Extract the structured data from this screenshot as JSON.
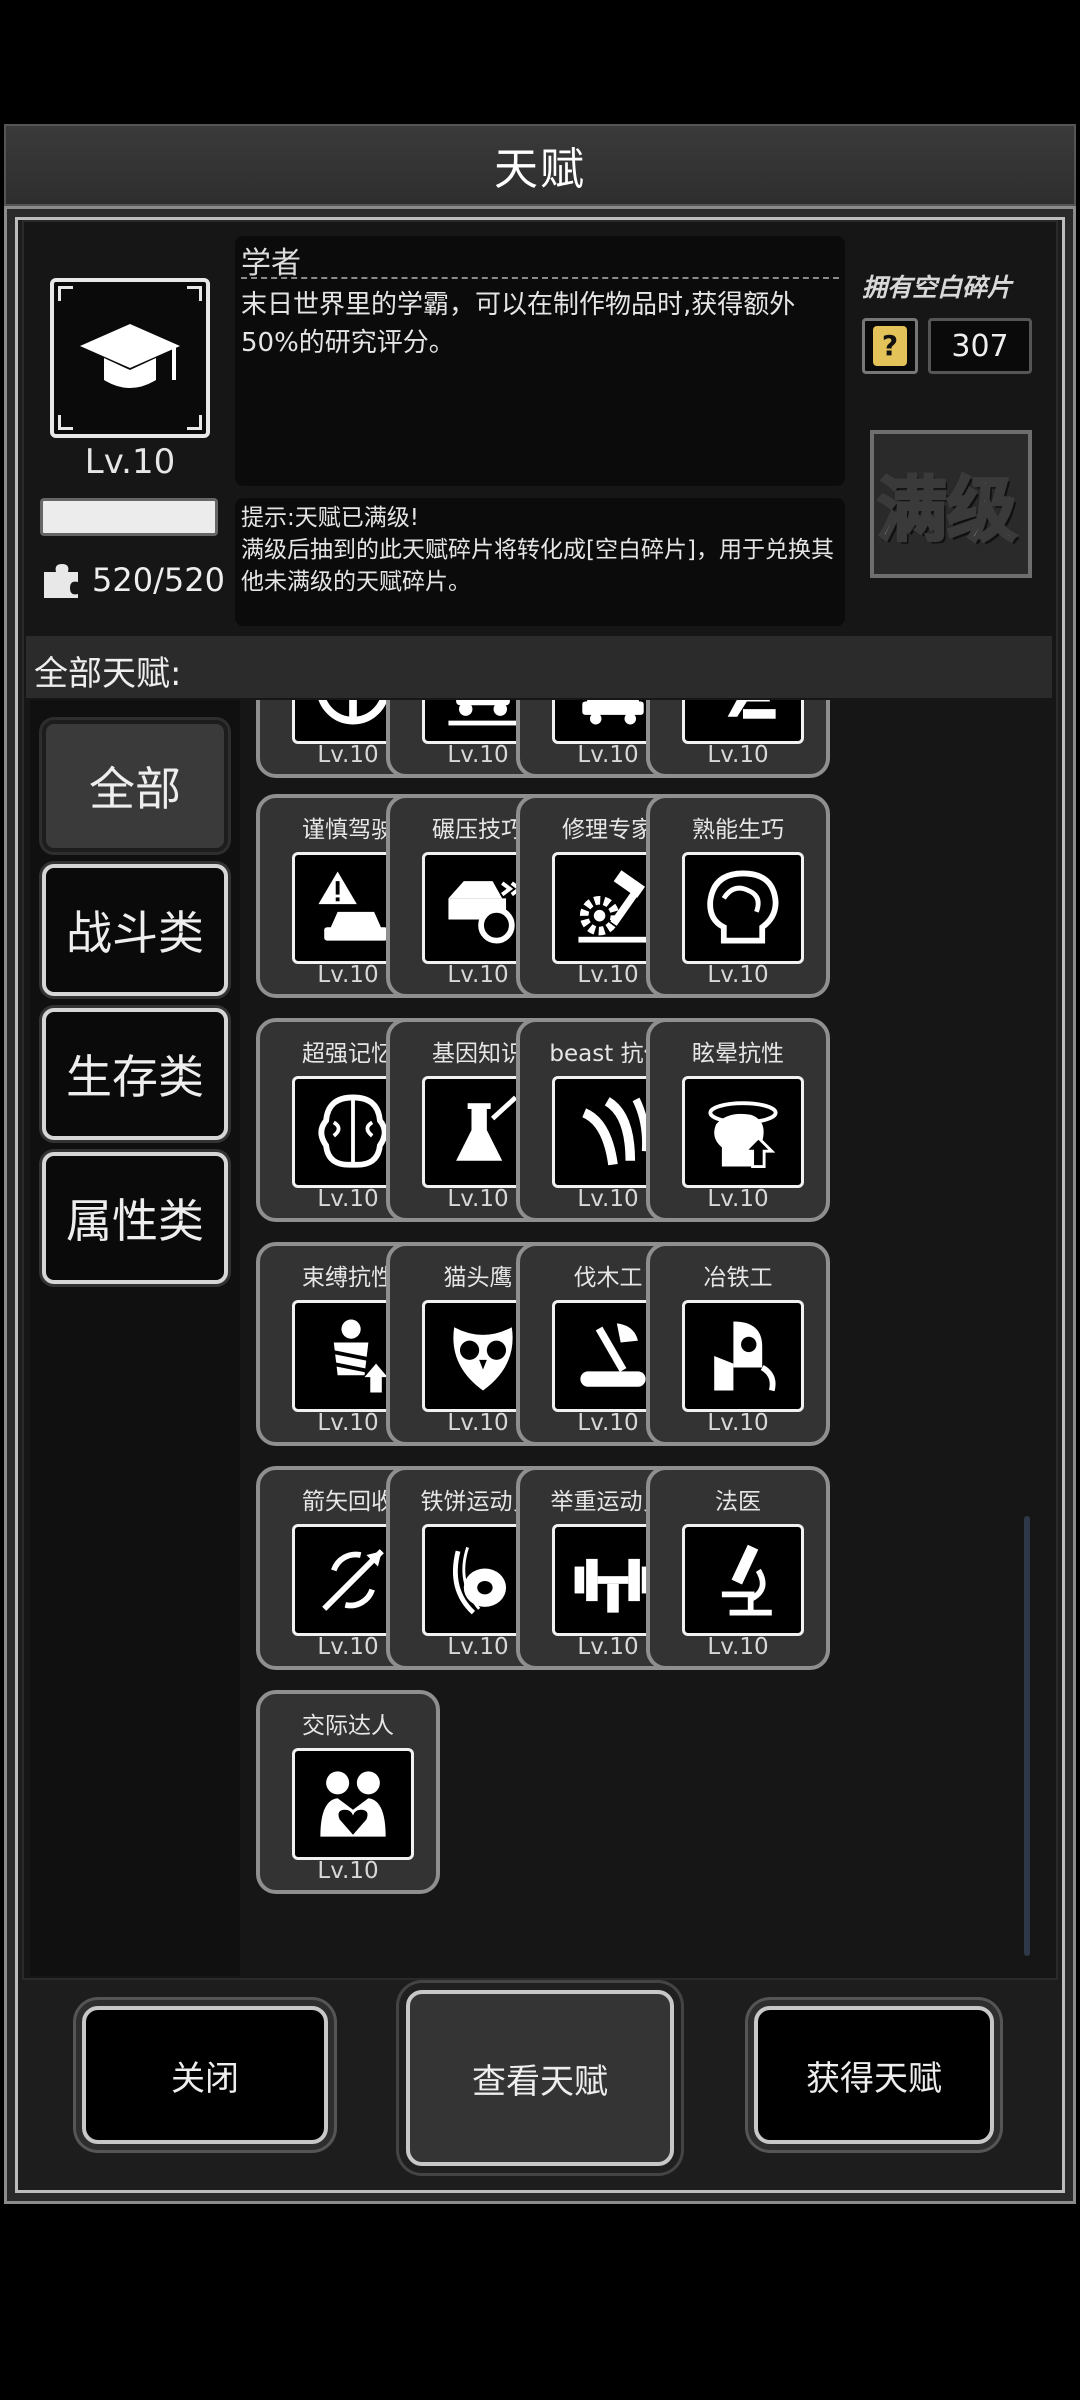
{
  "title": "天赋",
  "selected": {
    "name": "学者",
    "level": "Lv.10",
    "description": "末日世界里的学霸，可以在制作物品时,获得额外50%的研究评分。",
    "hint_line1": "提示:天赋已满级!",
    "hint_line2": "满级后抽到的此天赋碎片将转化成[空白碎片]，用于兑换其他未满级的天赋碎片。",
    "fragments": "520/520",
    "xp_fill_fraction": 1.0,
    "icon": "graduation-cap-icon"
  },
  "blank_fragments": {
    "label": "拥有空白碎片",
    "count": "307",
    "icon": "question-card-icon"
  },
  "max_badge": "满级",
  "all_talents_label": "全部天赋:",
  "categories": [
    {
      "label": "全部",
      "active": true
    },
    {
      "label": "战斗类",
      "active": false
    },
    {
      "label": "生存类",
      "active": false
    },
    {
      "label": "属性类",
      "active": false
    }
  ],
  "talents": [
    {
      "name": "",
      "level": "Lv.10",
      "icon": "steering-wheel-icon"
    },
    {
      "name": "",
      "level": "Lv.10",
      "icon": "vehicle-repair-icon"
    },
    {
      "name": "",
      "level": "Lv.10",
      "icon": "car-tools-icon"
    },
    {
      "name": "",
      "level": "Lv.10",
      "icon": "driver-seat-icon"
    },
    {
      "name": "谨慎驾驶",
      "level": "Lv.10",
      "icon": "warning-car-icon"
    },
    {
      "name": "碾压技巧",
      "level": "Lv.10",
      "icon": "car-crush-icon"
    },
    {
      "name": "修理专家",
      "level": "Lv.10",
      "icon": "gear-hammer-icon"
    },
    {
      "name": "熟能生巧",
      "level": "Lv.10",
      "icon": "brain-head-icon"
    },
    {
      "name": "超强记忆",
      "level": "Lv.10",
      "icon": "brain-icon"
    },
    {
      "name": "基因知识",
      "level": "Lv.10",
      "icon": "flask-icon"
    },
    {
      "name": "beast 抗体",
      "level": "Lv.10",
      "icon": "claw-mark-icon"
    },
    {
      "name": "眩晕抗性",
      "level": "Lv.10",
      "icon": "dizzy-head-icon"
    },
    {
      "name": "束缚抗性",
      "level": "Lv.10",
      "icon": "bound-person-icon"
    },
    {
      "name": "猫头鹰",
      "level": "Lv.10",
      "icon": "owl-icon"
    },
    {
      "name": "伐木工",
      "level": "Lv.10",
      "icon": "axe-log-icon"
    },
    {
      "name": "冶铁工",
      "level": "Lv.10",
      "icon": "smelter-icon"
    },
    {
      "name": "箭矢回收",
      "level": "Lv.10",
      "icon": "arrow-recycle-icon"
    },
    {
      "name": "铁饼运动员",
      "level": "Lv.10",
      "icon": "discus-icon"
    },
    {
      "name": "举重运动员",
      "level": "Lv.10",
      "icon": "dumbbell-icon"
    },
    {
      "name": "法医",
      "level": "Lv.10",
      "icon": "microscope-icon"
    },
    {
      "name": "交际达人",
      "level": "Lv.10",
      "icon": "hug-heart-icon"
    }
  ],
  "buttons": {
    "close": "关闭",
    "view": "查看天赋",
    "get": "获得天赋"
  }
}
